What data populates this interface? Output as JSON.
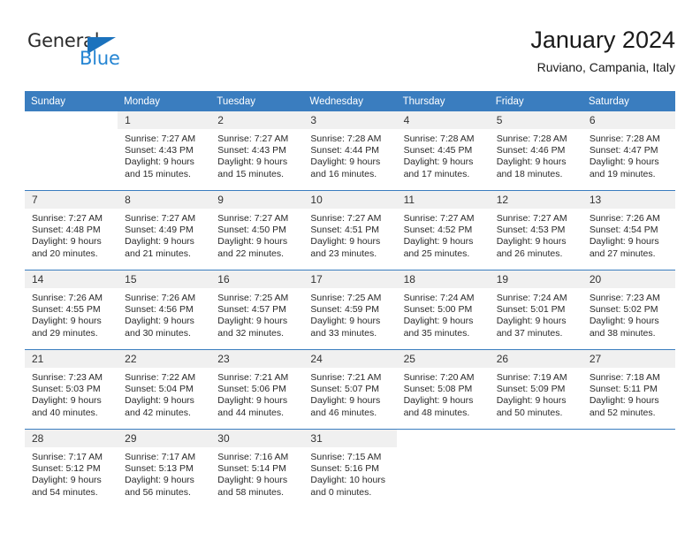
{
  "brand": {
    "name_dark": "General",
    "name_blue": "Blue",
    "accent_color": "#1b72bd",
    "light_blue": "#2585d3"
  },
  "header": {
    "title": "January 2024",
    "subtitle": "Ruviano, Campania, Italy"
  },
  "theme": {
    "header_row_bg": "#3a7dbf",
    "daynum_bg": "#f0f0f0",
    "text_color": "#2a2a2a"
  },
  "weekday_headers": [
    "Sunday",
    "Monday",
    "Tuesday",
    "Wednesday",
    "Thursday",
    "Friday",
    "Saturday"
  ],
  "weeks": [
    [
      {
        "day": "",
        "sunrise": "",
        "sunset": "",
        "daylight1": "",
        "daylight2": "",
        "blank": true
      },
      {
        "day": "1",
        "sunrise": "Sunrise: 7:27 AM",
        "sunset": "Sunset: 4:43 PM",
        "daylight1": "Daylight: 9 hours",
        "daylight2": "and 15 minutes."
      },
      {
        "day": "2",
        "sunrise": "Sunrise: 7:27 AM",
        "sunset": "Sunset: 4:43 PM",
        "daylight1": "Daylight: 9 hours",
        "daylight2": "and 15 minutes."
      },
      {
        "day": "3",
        "sunrise": "Sunrise: 7:28 AM",
        "sunset": "Sunset: 4:44 PM",
        "daylight1": "Daylight: 9 hours",
        "daylight2": "and 16 minutes."
      },
      {
        "day": "4",
        "sunrise": "Sunrise: 7:28 AM",
        "sunset": "Sunset: 4:45 PM",
        "daylight1": "Daylight: 9 hours",
        "daylight2": "and 17 minutes."
      },
      {
        "day": "5",
        "sunrise": "Sunrise: 7:28 AM",
        "sunset": "Sunset: 4:46 PM",
        "daylight1": "Daylight: 9 hours",
        "daylight2": "and 18 minutes."
      },
      {
        "day": "6",
        "sunrise": "Sunrise: 7:28 AM",
        "sunset": "Sunset: 4:47 PM",
        "daylight1": "Daylight: 9 hours",
        "daylight2": "and 19 minutes."
      }
    ],
    [
      {
        "day": "7",
        "sunrise": "Sunrise: 7:27 AM",
        "sunset": "Sunset: 4:48 PM",
        "daylight1": "Daylight: 9 hours",
        "daylight2": "and 20 minutes."
      },
      {
        "day": "8",
        "sunrise": "Sunrise: 7:27 AM",
        "sunset": "Sunset: 4:49 PM",
        "daylight1": "Daylight: 9 hours",
        "daylight2": "and 21 minutes."
      },
      {
        "day": "9",
        "sunrise": "Sunrise: 7:27 AM",
        "sunset": "Sunset: 4:50 PM",
        "daylight1": "Daylight: 9 hours",
        "daylight2": "and 22 minutes."
      },
      {
        "day": "10",
        "sunrise": "Sunrise: 7:27 AM",
        "sunset": "Sunset: 4:51 PM",
        "daylight1": "Daylight: 9 hours",
        "daylight2": "and 23 minutes."
      },
      {
        "day": "11",
        "sunrise": "Sunrise: 7:27 AM",
        "sunset": "Sunset: 4:52 PM",
        "daylight1": "Daylight: 9 hours",
        "daylight2": "and 25 minutes."
      },
      {
        "day": "12",
        "sunrise": "Sunrise: 7:27 AM",
        "sunset": "Sunset: 4:53 PM",
        "daylight1": "Daylight: 9 hours",
        "daylight2": "and 26 minutes."
      },
      {
        "day": "13",
        "sunrise": "Sunrise: 7:26 AM",
        "sunset": "Sunset: 4:54 PM",
        "daylight1": "Daylight: 9 hours",
        "daylight2": "and 27 minutes."
      }
    ],
    [
      {
        "day": "14",
        "sunrise": "Sunrise: 7:26 AM",
        "sunset": "Sunset: 4:55 PM",
        "daylight1": "Daylight: 9 hours",
        "daylight2": "and 29 minutes."
      },
      {
        "day": "15",
        "sunrise": "Sunrise: 7:26 AM",
        "sunset": "Sunset: 4:56 PM",
        "daylight1": "Daylight: 9 hours",
        "daylight2": "and 30 minutes."
      },
      {
        "day": "16",
        "sunrise": "Sunrise: 7:25 AM",
        "sunset": "Sunset: 4:57 PM",
        "daylight1": "Daylight: 9 hours",
        "daylight2": "and 32 minutes."
      },
      {
        "day": "17",
        "sunrise": "Sunrise: 7:25 AM",
        "sunset": "Sunset: 4:59 PM",
        "daylight1": "Daylight: 9 hours",
        "daylight2": "and 33 minutes."
      },
      {
        "day": "18",
        "sunrise": "Sunrise: 7:24 AM",
        "sunset": "Sunset: 5:00 PM",
        "daylight1": "Daylight: 9 hours",
        "daylight2": "and 35 minutes."
      },
      {
        "day": "19",
        "sunrise": "Sunrise: 7:24 AM",
        "sunset": "Sunset: 5:01 PM",
        "daylight1": "Daylight: 9 hours",
        "daylight2": "and 37 minutes."
      },
      {
        "day": "20",
        "sunrise": "Sunrise: 7:23 AM",
        "sunset": "Sunset: 5:02 PM",
        "daylight1": "Daylight: 9 hours",
        "daylight2": "and 38 minutes."
      }
    ],
    [
      {
        "day": "21",
        "sunrise": "Sunrise: 7:23 AM",
        "sunset": "Sunset: 5:03 PM",
        "daylight1": "Daylight: 9 hours",
        "daylight2": "and 40 minutes."
      },
      {
        "day": "22",
        "sunrise": "Sunrise: 7:22 AM",
        "sunset": "Sunset: 5:04 PM",
        "daylight1": "Daylight: 9 hours",
        "daylight2": "and 42 minutes."
      },
      {
        "day": "23",
        "sunrise": "Sunrise: 7:21 AM",
        "sunset": "Sunset: 5:06 PM",
        "daylight1": "Daylight: 9 hours",
        "daylight2": "and 44 minutes."
      },
      {
        "day": "24",
        "sunrise": "Sunrise: 7:21 AM",
        "sunset": "Sunset: 5:07 PM",
        "daylight1": "Daylight: 9 hours",
        "daylight2": "and 46 minutes."
      },
      {
        "day": "25",
        "sunrise": "Sunrise: 7:20 AM",
        "sunset": "Sunset: 5:08 PM",
        "daylight1": "Daylight: 9 hours",
        "daylight2": "and 48 minutes."
      },
      {
        "day": "26",
        "sunrise": "Sunrise: 7:19 AM",
        "sunset": "Sunset: 5:09 PM",
        "daylight1": "Daylight: 9 hours",
        "daylight2": "and 50 minutes."
      },
      {
        "day": "27",
        "sunrise": "Sunrise: 7:18 AM",
        "sunset": "Sunset: 5:11 PM",
        "daylight1": "Daylight: 9 hours",
        "daylight2": "and 52 minutes."
      }
    ],
    [
      {
        "day": "28",
        "sunrise": "Sunrise: 7:17 AM",
        "sunset": "Sunset: 5:12 PM",
        "daylight1": "Daylight: 9 hours",
        "daylight2": "and 54 minutes."
      },
      {
        "day": "29",
        "sunrise": "Sunrise: 7:17 AM",
        "sunset": "Sunset: 5:13 PM",
        "daylight1": "Daylight: 9 hours",
        "daylight2": "and 56 minutes."
      },
      {
        "day": "30",
        "sunrise": "Sunrise: 7:16 AM",
        "sunset": "Sunset: 5:14 PM",
        "daylight1": "Daylight: 9 hours",
        "daylight2": "and 58 minutes."
      },
      {
        "day": "31",
        "sunrise": "Sunrise: 7:15 AM",
        "sunset": "Sunset: 5:16 PM",
        "daylight1": "Daylight: 10 hours",
        "daylight2": "and 0 minutes."
      },
      {
        "day": "",
        "sunrise": "",
        "sunset": "",
        "daylight1": "",
        "daylight2": "",
        "blank": true
      },
      {
        "day": "",
        "sunrise": "",
        "sunset": "",
        "daylight1": "",
        "daylight2": "",
        "blank": true
      },
      {
        "day": "",
        "sunrise": "",
        "sunset": "",
        "daylight1": "",
        "daylight2": "",
        "blank": true
      }
    ]
  ]
}
